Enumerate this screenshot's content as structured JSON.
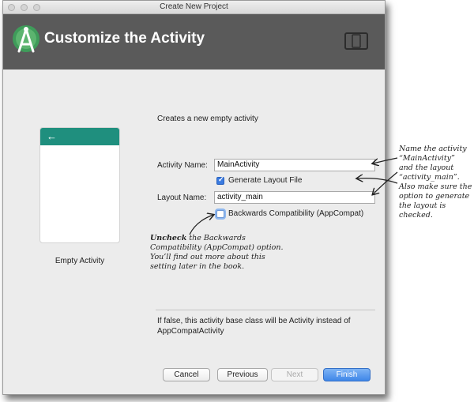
{
  "window": {
    "title": "Create New Project"
  },
  "header": {
    "title": "Customize the Activity",
    "logo_icon": "android-studio-logo-icon",
    "device_icon": "device-frame-icon"
  },
  "preview": {
    "back_glyph": "←",
    "caption": "Empty Activity",
    "bar_color": "#1f8f7e"
  },
  "form": {
    "description": "Creates a new empty activity",
    "activity_name_label": "Activity Name:",
    "activity_name_value": "MainActivity",
    "generate_layout_label": "Generate Layout File",
    "generate_layout_checked": true,
    "layout_name_label": "Layout Name:",
    "layout_name_value": "activity_main",
    "backwards_compat_label": "Backwards Compatibility (AppCompat)",
    "backwards_compat_checked": false
  },
  "note": {
    "line1": "If false, this activity base class will be Activity instead of",
    "line2": "AppCompatActivity"
  },
  "buttons": {
    "cancel": "Cancel",
    "previous": "Previous",
    "next": "Next",
    "finish": "Finish",
    "accent_color": "#3f86e8"
  },
  "annotations": {
    "right": [
      "Name the activity",
      "“MainActivity”",
      "and the layout",
      "“activity_main”.",
      "Also make sure the",
      "option to generate",
      "the layout is",
      "checked."
    ],
    "bottom_bold": "Uncheck",
    "bottom_line1_rest": " the Backwards",
    "bottom_lines": [
      "Compatibility (AppCompat) option.",
      "You’ll find out more about this",
      "setting later in the book."
    ]
  }
}
